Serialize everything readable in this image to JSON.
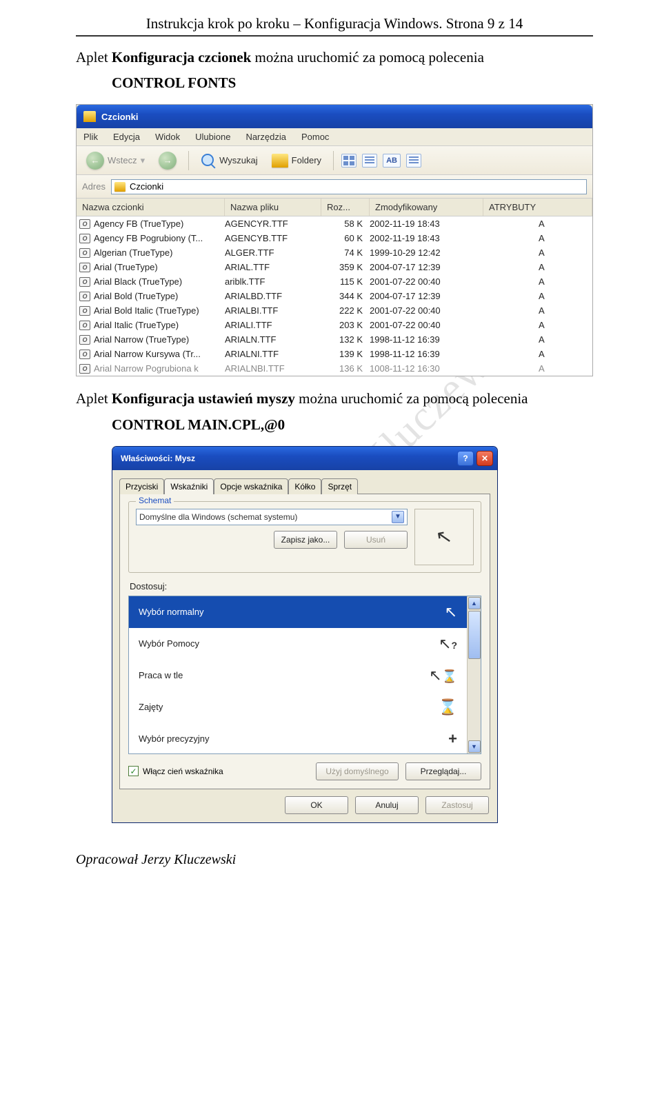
{
  "doc": {
    "header": "Instrukcja krok po kroku – Konfiguracja Windows.  Strona 9 z 14",
    "para1_prefix": "Aplet ",
    "para1_bold": "Konfiguracja czcionek",
    "para1_suffix": "  można uruchomić za pomocą polecenia",
    "cmd1": "CONTROL  FONTS",
    "para2_prefix": "Aplet ",
    "para2_bold": "Konfiguracja ustawień myszy",
    "para2_suffix": "  można uruchomić za pomocą polecenia",
    "cmd2": "CONTROL  MAIN.CPL,@0",
    "footer": "Opracował Jerzy Kluczewski",
    "watermark": "Copyright Kluczewski"
  },
  "fonts_window": {
    "title": "Czcionki",
    "menu": [
      "Plik",
      "Edycja",
      "Widok",
      "Ulubione",
      "Narzędzia",
      "Pomoc"
    ],
    "toolbar": {
      "back": "Wstecz",
      "search": "Wyszukaj",
      "folders": "Foldery",
      "ab": "AB"
    },
    "address_label": "Adres",
    "address_value": "Czcionki",
    "columns": {
      "name": "Nazwa czcionki",
      "file": "Nazwa pliku",
      "size": "Roz...",
      "modified": "Zmodyfikowany",
      "attrs": "ATRYBUTY"
    },
    "rows": [
      {
        "name": "Agency FB (TrueType)",
        "file": "AGENCYR.TTF",
        "size": "58 K",
        "mod": "2002-11-19 18:43",
        "attr": "A"
      },
      {
        "name": "Agency FB Pogrubiony (T...",
        "file": "AGENCYB.TTF",
        "size": "60 K",
        "mod": "2002-11-19 18:43",
        "attr": "A"
      },
      {
        "name": "Algerian (TrueType)",
        "file": "ALGER.TTF",
        "size": "74 K",
        "mod": "1999-10-29 12:42",
        "attr": "A"
      },
      {
        "name": "Arial (TrueType)",
        "file": "ARIAL.TTF",
        "size": "359 K",
        "mod": "2004-07-17 12:39",
        "attr": "A"
      },
      {
        "name": "Arial Black (TrueType)",
        "file": "ariblk.TTF",
        "size": "115 K",
        "mod": "2001-07-22 00:40",
        "attr": "A"
      },
      {
        "name": "Arial Bold (TrueType)",
        "file": "ARIALBD.TTF",
        "size": "344 K",
        "mod": "2004-07-17 12:39",
        "attr": "A"
      },
      {
        "name": "Arial Bold Italic (TrueType)",
        "file": "ARIALBI.TTF",
        "size": "222 K",
        "mod": "2001-07-22 00:40",
        "attr": "A"
      },
      {
        "name": "Arial Italic (TrueType)",
        "file": "ARIALI.TTF",
        "size": "203 K",
        "mod": "2001-07-22 00:40",
        "attr": "A"
      },
      {
        "name": "Arial Narrow (TrueType)",
        "file": "ARIALN.TTF",
        "size": "132 K",
        "mod": "1998-11-12 16:39",
        "attr": "A"
      },
      {
        "name": "Arial Narrow Kursywa (Tr...",
        "file": "ARIALNI.TTF",
        "size": "139 K",
        "mod": "1998-11-12 16:39",
        "attr": "A"
      },
      {
        "name": "Arial Narrow Pogrubiona k",
        "file": "ARIALNBI.TTF",
        "size": "136 K",
        "mod": "1008-11-12 16:30",
        "attr": "A"
      }
    ]
  },
  "mouse_dialog": {
    "title": "Właściwości: Mysz",
    "tabs": [
      "Przyciski",
      "Wskaźniki",
      "Opcje wskaźnika",
      "Kółko",
      "Sprzęt"
    ],
    "active_tab": "Wskaźniki",
    "scheme_label": "Schemat",
    "scheme_value": "Domyślne dla Windows (schemat systemu)",
    "save_as": "Zapisz jako...",
    "delete": "Usuń",
    "customize": "Dostosuj:",
    "items": [
      {
        "label": "Wybór normalny",
        "selected": true,
        "icon": "arrow"
      },
      {
        "label": "Wybór Pomocy",
        "selected": false,
        "icon": "help"
      },
      {
        "label": "Praca w tle",
        "selected": false,
        "icon": "arrow-glass"
      },
      {
        "label": "Zajęty",
        "selected": false,
        "icon": "hourglass"
      },
      {
        "label": "Wybór precyzyjny",
        "selected": false,
        "icon": "crosshair"
      }
    ],
    "shadow": "Włącz cień wskaźnika",
    "use_default": "Użyj domyślnego",
    "browse": "Przeglądaj...",
    "ok": "OK",
    "cancel": "Anuluj",
    "apply": "Zastosuj"
  }
}
